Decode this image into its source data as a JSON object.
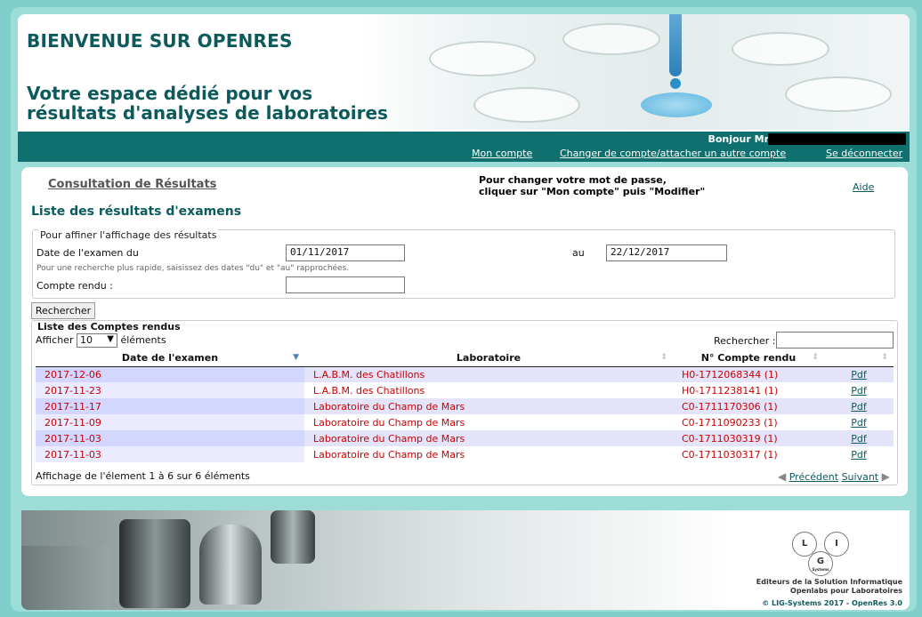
{
  "header": {
    "welcome": "BIENVENUE SUR OPENRES",
    "tagline_line1": "Votre espace dédié pour vos",
    "tagline_line2": "résultats d'analyses de laboratoires",
    "greeting": "Bonjour Mr",
    "links": {
      "account": "Mon compte",
      "switch_account": "Changer de compte/attacher un autre compte",
      "logout": "Se déconnecter"
    }
  },
  "content": {
    "breadcrumb": "Consultation de Résultats",
    "password_note_line1": "Pour changer votre mot de passe,",
    "password_note_line2": "cliquer sur \"Mon compte\" puis \"Modifier\"",
    "help": "Aide",
    "title": "Liste des résultats d'examens"
  },
  "filter": {
    "legend": "Pour affiner l'affichage des résultats",
    "date_label": "Date de l'examen du",
    "date_from": "01/11/2017",
    "to_label": "au",
    "date_to": "22/12/2017",
    "hint": "Pour une recherche plus rapide, saisissez des dates \"du\" et \"au\" rapprochées.",
    "report_label": "Compte rendu :",
    "report_value": "",
    "search_button": "Rechercher"
  },
  "results": {
    "legend": "Liste des Comptes rendus",
    "show_label": "Afficher",
    "page_size": "10",
    "elements_label": "éléments",
    "search_label": "Rechercher :",
    "search_value": "",
    "columns": [
      "Date de l'examen",
      "Laboratoire",
      "N° Compte rendu",
      ""
    ],
    "rows": [
      {
        "date": "2017-12-06",
        "lab": "L.A.B.M. des Chatillons",
        "report": "H0-1712068344 (1)",
        "pdf": "Pdf"
      },
      {
        "date": "2017-11-23",
        "lab": "L.A.B.M. des Chatillons",
        "report": "H0-1711238141 (1)",
        "pdf": "Pdf"
      },
      {
        "date": "2017-11-17",
        "lab": "Laboratoire du Champ de Mars",
        "report": "C0-1711170306 (1)",
        "pdf": "Pdf"
      },
      {
        "date": "2017-11-09",
        "lab": "Laboratoire du Champ de Mars",
        "report": "C0-1711090233 (1)",
        "pdf": "Pdf"
      },
      {
        "date": "2017-11-03",
        "lab": "Laboratoire du Champ de Mars",
        "report": "C0-1711030319 (1)",
        "pdf": "Pdf"
      },
      {
        "date": "2017-11-03",
        "lab": "Laboratoire du Champ de Mars",
        "report": "C0-1711030317 (1)",
        "pdf": "Pdf"
      }
    ],
    "info": "Affichage de l'élement 1 à 6 sur 6 éléments",
    "prev": "Précédent",
    "next": "Suivant"
  },
  "footer": {
    "logo_letters": [
      "L",
      "I",
      "G"
    ],
    "logo_sub": "Systems",
    "line1": "Editeurs de la Solution Informatique",
    "line2": "Openlabs pour Laboratoires",
    "copyright": "© LIG-Systems 2017 - OpenRes 3.0"
  }
}
